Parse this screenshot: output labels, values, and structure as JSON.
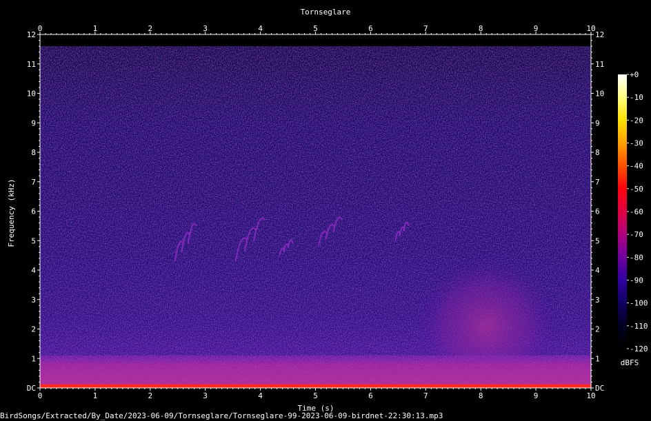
{
  "title": "Tornseglare",
  "footer_filename": "BirdSongs/Extracted/By_Date/2023-06-09/Tornseglare/Tornseglare-99-2023-06-09-birdnet-22:30:13.mp3",
  "chart_data": {
    "type": "heatmap",
    "title": "Tornseglare",
    "xlabel": "Time (s)",
    "ylabel": "Frequency (kHz)",
    "xlim": [
      0,
      10
    ],
    "ylim": [
      0,
      12
    ],
    "x_ticks": [
      "0",
      "1",
      "2",
      "3",
      "4",
      "5",
      "6",
      "7",
      "8",
      "9",
      "10"
    ],
    "y_ticks": [
      "DC",
      "1",
      "2",
      "3",
      "4",
      "5",
      "6",
      "7",
      "8",
      "9",
      "10",
      "11",
      "12"
    ],
    "colorbar": {
      "label": "dBFS",
      "range": [
        -120,
        0
      ],
      "ticks": [
        "+0",
        "-10",
        "-20",
        "-30",
        "-40",
        "-50",
        "-60",
        "-70",
        "-80",
        "-90",
        "-100",
        "-110",
        "-120"
      ],
      "colors": [
        "#ffffff",
        "#ffff80",
        "#ffe000",
        "#ffa000",
        "#ff5000",
        "#ff0010",
        "#e00040",
        "#b00080",
        "#7000a0",
        "#3000a0",
        "#100060",
        "#000020",
        "#000000"
      ]
    },
    "regions": [
      {
        "label": "broadband low-frequency noise",
        "t_start": 0,
        "t_end": 10,
        "f_low": 0,
        "f_high": 1.1,
        "level_dbfs": -55
      },
      {
        "label": "DC line",
        "t_start": 0,
        "t_end": 10,
        "f_low": 0,
        "f_high": 0.1,
        "level_dbfs": -40
      },
      {
        "label": "noise burst",
        "t_start": 7.0,
        "t_end": 9.2,
        "f_low": 1.0,
        "f_high": 4.0,
        "level_dbfs": -75
      }
    ],
    "calls": [
      {
        "t_start": 2.45,
        "t_end": 2.85,
        "f_low": 4.3,
        "f_high": 5.8
      },
      {
        "t_start": 3.55,
        "t_end": 4.1,
        "f_low": 4.3,
        "f_high": 6.0
      },
      {
        "t_start": 4.35,
        "t_end": 4.6,
        "f_low": 4.5,
        "f_high": 5.2
      },
      {
        "t_start": 5.05,
        "t_end": 5.5,
        "f_low": 4.8,
        "f_high": 6.0
      },
      {
        "t_start": 6.45,
        "t_end": 6.7,
        "f_low": 5.0,
        "f_high": 5.8
      }
    ]
  }
}
